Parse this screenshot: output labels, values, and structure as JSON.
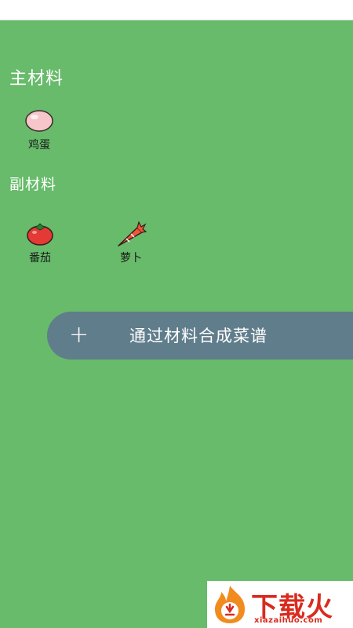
{
  "sections": {
    "main": {
      "title": "主材料",
      "items": [
        {
          "label": "鸡蛋",
          "icon": "egg-icon"
        }
      ]
    },
    "sub": {
      "title": "副材料",
      "items": [
        {
          "label": "番茄",
          "icon": "tomato-icon"
        },
        {
          "label": "萝卜",
          "icon": "carrot-icon"
        }
      ]
    }
  },
  "action": {
    "plus": "+",
    "label": "通过材料合成菜谱"
  },
  "watermark": {
    "text": "下载火",
    "url": "xiazaihuo.com"
  },
  "colors": {
    "background": "#67BB6A",
    "button": "#607D8B",
    "watermark_red": "#D92B1E"
  }
}
